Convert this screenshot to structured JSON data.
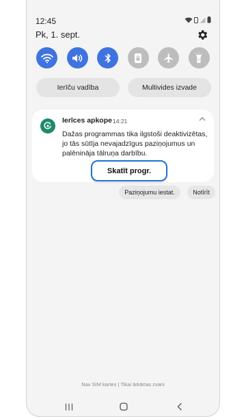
{
  "status_bar": {
    "time": "12:45"
  },
  "header": {
    "date": "Pk, 1. sept."
  },
  "quick_settings": {
    "tiles": [
      {
        "name": "wifi-icon",
        "state": "on"
      },
      {
        "name": "sound-icon",
        "state": "on"
      },
      {
        "name": "bluetooth-icon",
        "state": "on"
      },
      {
        "name": "lock-icon",
        "state": "off"
      },
      {
        "name": "airplane-icon",
        "state": "off"
      },
      {
        "name": "flashlight-icon",
        "state": "off"
      }
    ],
    "device_control_label": "Ierīču vadība",
    "media_output_label": "Multivides izvade"
  },
  "notification": {
    "app_name": "Ierīces apkope",
    "time": "14:21",
    "body": "Dažas programmas tika ilgstoši deaktivizētas, jo tās sūtīja nevajadzīgus paziņojumus un palēnināja tālruņa darbību.",
    "action_label": "Skatīt progr."
  },
  "notification_buttons": {
    "settings_label": "Paziņojumu iestat.",
    "clear_label": "Notīrīt"
  },
  "carrier_text": "Nav SIM kartes | Tikai ārkārtas zvani",
  "colors": {
    "accent": "#3e73e0",
    "inactive": "#bdbdbd",
    "app_icon": "#1e8a6c",
    "highlight": "#1e73d8"
  }
}
